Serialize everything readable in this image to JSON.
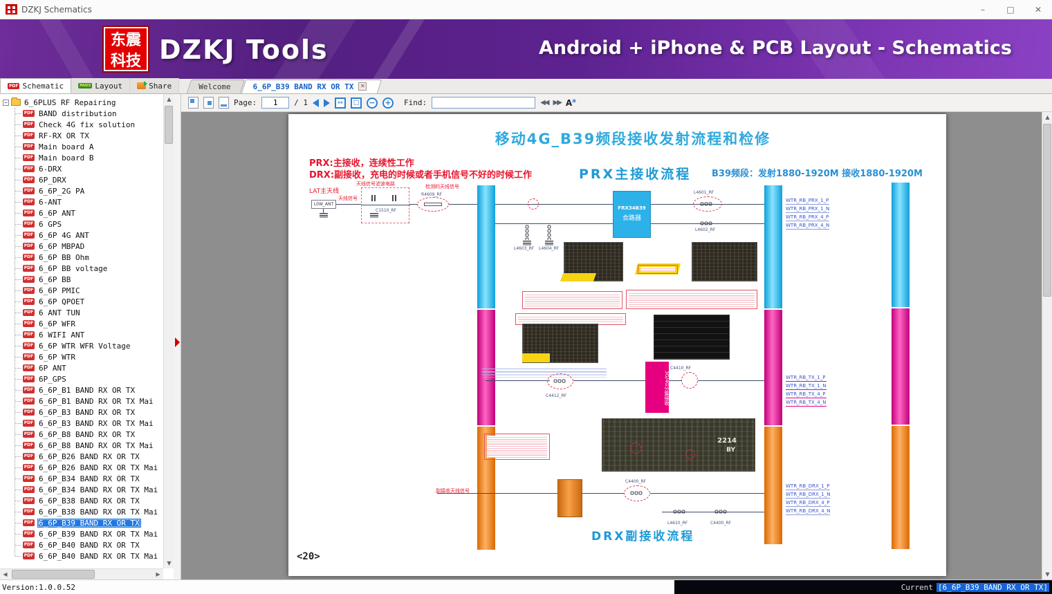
{
  "window": {
    "title": "DZKJ Schematics",
    "controls": {
      "minimize": "–",
      "maximize": "□",
      "close": "✕"
    }
  },
  "banner": {
    "logo_line1": "东震",
    "logo_line2": "科技",
    "app_title": "DZKJ Tools",
    "subtitle": "Android + iPhone & PCB Layout - Schematics"
  },
  "main_tabs": [
    {
      "label": "Schematic",
      "badge": "PDF"
    },
    {
      "label": "Layout",
      "badge": "PADS"
    },
    {
      "label": "Share",
      "badge": ""
    }
  ],
  "doc_tabs": [
    {
      "label": "Welcome"
    },
    {
      "label": "6_6P_B39 BAND RX OR TX",
      "close": "✕"
    }
  ],
  "toolbar": {
    "page_label": "Page:",
    "page_current": "1",
    "page_total": "/ 1",
    "find_label": "Find:",
    "find_value": ""
  },
  "tree": {
    "root_label": "6_6PLUS RF Repairing",
    "pdf_badge": "PDF",
    "items": [
      {
        "label": "BAND distribution"
      },
      {
        "label": "Check 4G fix  solution"
      },
      {
        "label": "RF-RX OR TX"
      },
      {
        "label": "Main board A"
      },
      {
        "label": "Main board B"
      },
      {
        "label": "6-DRX"
      },
      {
        "label": "6P_DRX"
      },
      {
        "label": "6_6P_2G PA"
      },
      {
        "label": "6-ANT"
      },
      {
        "label": "6_6P ANT"
      },
      {
        "label": "6 GPS"
      },
      {
        "label": "6_6P 4G ANT"
      },
      {
        "label": "6_6P MBPAD"
      },
      {
        "label": "6_6P BB Ohm"
      },
      {
        "label": "6_6P BB voltage"
      },
      {
        "label": "6_6P BB"
      },
      {
        "label": "6_6P PMIC"
      },
      {
        "label": "6_6P QPOET"
      },
      {
        "label": "6 ANT TUN"
      },
      {
        "label": "6_6P WFR"
      },
      {
        "label": "6 WIFI ANT"
      },
      {
        "label": "6_6P WTR WFR Voltage"
      },
      {
        "label": "6_6P WTR"
      },
      {
        "label": "6P ANT"
      },
      {
        "label": "6P_GPS"
      },
      {
        "label": "6_6P_B1 BAND RX OR TX"
      },
      {
        "label": "6_6P_B1 BAND RX OR TX Mai"
      },
      {
        "label": "6_6P_B3 BAND RX OR TX"
      },
      {
        "label": "6_6P_B3 BAND RX OR TX Mai"
      },
      {
        "label": "6_6P_B8 BAND RX OR TX"
      },
      {
        "label": "6_6P_B8 BAND RX OR TX Mai"
      },
      {
        "label": "6_6P_B26 BAND RX OR TX"
      },
      {
        "label": "6_6P_B26 BAND RX OR TX Mai"
      },
      {
        "label": "6_6P_B34 BAND RX OR TX"
      },
      {
        "label": "6_6P_B34 BAND RX OR TX Mai"
      },
      {
        "label": "6_6P_B38 BAND RX OR TX"
      },
      {
        "label": "6_6P_B38 BAND RX OR TX Mai"
      },
      {
        "label": "6_6P_B39 BAND RX OR TX",
        "selected": true
      },
      {
        "label": "6_6P_B39 BAND RX OR TX Mai"
      },
      {
        "label": "6_6P_B40 BAND RX OR TX"
      },
      {
        "label": "6_6P_B40 BAND RX OR TX Mai"
      }
    ]
  },
  "statusbar": {
    "version": "Version:1.0.0.52",
    "current_label": "Current",
    "current_value": "[6_6P_B39 BAND RX OR TX]"
  },
  "schematic": {
    "title": "移动4G_B39频段接收发射流程和检修",
    "prx_note": "PRX:主接收，连续性工作",
    "drx_note": "DRX:副接收，充电的时候或者手机信号不好的时候工作",
    "prx_flow_label": "PRX主接收流程",
    "band_label": "B39频段：发射1880-1920M  接收1880-1920M",
    "drx_flow_label": "DRX副接收流程",
    "drx_ant_label": "副接收天线信号",
    "page_marker": "<20>",
    "antenna_label": "LAT主天线",
    "ant_signal_label": "天线信号",
    "filter_label": "天线信号滤波电路",
    "detect_label": "检测的天线信号",
    "combiner_name": "FRX34B39",
    "combiner_sub": "合路器",
    "divider_label": "3G/4G分集接收",
    "chip_marking": {
      "line1": "2214",
      "line2": "BY"
    },
    "components": {
      "l0w_ant": "L0W_ANT",
      "c1510": "C1510_RF",
      "r4609": "R4609_RF",
      "l4601": "L4601_RF",
      "l4602": "L4602_RF",
      "l4603": "L4603_RF",
      "l4604": "L4604_RF",
      "c4412": "C4412_RF",
      "c4410": "C4410_RF",
      "c4400": "C4400_RF",
      "l4610": "L4610_RF"
    },
    "prx_nets": [
      "WTR_RB_PRX_1_P",
      "WTR_RB_PRX_1_N",
      "WTR_RB_PRX_4_P",
      "WTR_RB_PRX_4_N"
    ],
    "tx_nets": [
      "WTR_RB_TX_1_P",
      "WTR_RB_TX_1_N",
      "WTR_RB_TX_4_P",
      "WTR_RB_TX_4_N"
    ],
    "drx_nets": [
      "WTR_RB_DRX_1_P",
      "WTR_RB_DRX_1_N",
      "WTR_RB_DRX_4_P",
      "WTR_RB_DRX_4_N"
    ]
  }
}
